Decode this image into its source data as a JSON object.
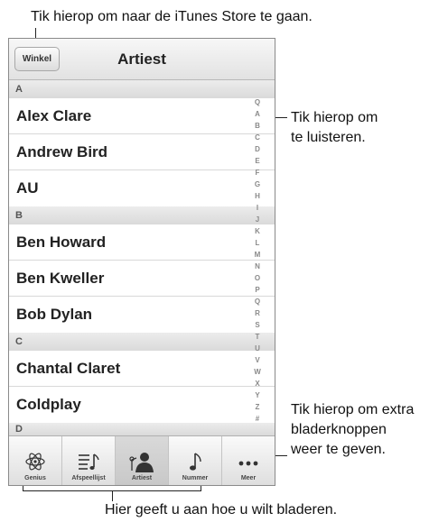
{
  "callouts": {
    "store": "Tik hierop om naar de iTunes Store te gaan.",
    "listen": [
      "Tik hierop om",
      "te luisteren."
    ],
    "more": [
      "Tik hierop om extra",
      "bladerknoppen",
      "weer te geven."
    ],
    "browse": "Hier geeft u aan hoe u wilt bladeren."
  },
  "navbar": {
    "store_label": "Winkel",
    "title": "Artiest"
  },
  "sections": [
    {
      "header": "A",
      "items": [
        "Alex Clare",
        "Andrew Bird",
        "AU"
      ]
    },
    {
      "header": "B",
      "items": [
        "Ben Howard",
        "Ben Kweller",
        "Bob Dylan"
      ]
    },
    {
      "header": "C",
      "items": [
        "Chantal Claret",
        "Coldplay"
      ]
    },
    {
      "header": "D",
      "items": []
    }
  ],
  "index": [
    "Q",
    "A",
    "B",
    "C",
    "D",
    "E",
    "F",
    "G",
    "H",
    "I",
    "J",
    "K",
    "L",
    "M",
    "N",
    "O",
    "P",
    "Q",
    "R",
    "S",
    "T",
    "U",
    "V",
    "W",
    "X",
    "Y",
    "Z",
    "#"
  ],
  "tabs": [
    {
      "label": "Genius",
      "icon": "atom-icon"
    },
    {
      "label": "Afspeellijst",
      "icon": "playlist-icon"
    },
    {
      "label": "Artiest",
      "icon": "artist-icon",
      "active": true
    },
    {
      "label": "Nummer",
      "icon": "music-note-icon"
    },
    {
      "label": "Meer",
      "icon": "more-dots-icon"
    }
  ]
}
